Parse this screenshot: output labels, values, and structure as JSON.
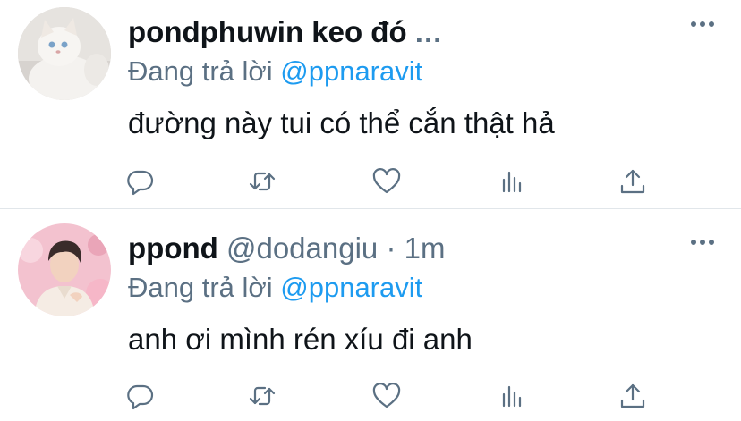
{
  "tweets": [
    {
      "display_name": "pondphuwin keo đó",
      "handle": "",
      "ellipsis": "...",
      "time": "",
      "reply_prefix": "Đang trả lời",
      "reply_mention": "@ppnaravit",
      "text": "đường này tui có thể cắn thật hả",
      "avatar": "white-kitten-avatar"
    },
    {
      "display_name": "ppond",
      "handle": "@dodangiu",
      "ellipsis": "",
      "separator": "·",
      "time": "1m",
      "reply_prefix": "Đang trả lời",
      "reply_mention": "@ppnaravit",
      "text": "anh ơi mình rén xíu đi anh",
      "avatar": "person-pink-background-avatar"
    }
  ],
  "colors": {
    "text_primary": "#0f1419",
    "text_secondary": "#5b7083",
    "accent": "#1d9bf0",
    "divider": "#e1e6ea"
  },
  "icons": [
    "reply-icon",
    "retweet-icon",
    "like-icon",
    "stats-icon",
    "share-icon",
    "more-options-icon"
  ]
}
